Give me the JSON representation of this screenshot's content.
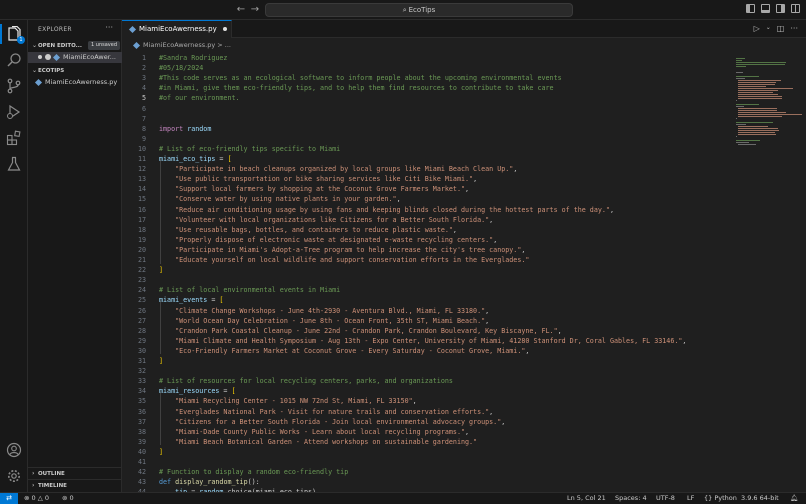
{
  "titlebar": {
    "search_text": "EcoTips"
  },
  "activity": {
    "explorer_badge": "1"
  },
  "sidebar": {
    "header": "EXPLORER",
    "more": "···",
    "open_editors_label": "OPEN EDITO...",
    "unsaved_label": "1 unsaved",
    "open_editor_file": "MiamiEcoAwer...",
    "folder_label": "ECOTIPS",
    "folder_file": "MiamiEcoAwerness.py",
    "outline_label": "OUTLINE",
    "timeline_label": "TIMELINE"
  },
  "editor": {
    "tab_label": "MiamiEcoAwerness.py",
    "breadcrumb": "MiamiEcoAwerness.py > ...",
    "current_line": 5,
    "lines": [
      "#Sandra Rodriguez",
      "#05/18/2024",
      "#This code serves as an ecological software to inform people about the upcoming environmental events",
      "#in Miami, give them eco-friendly tips, and to help them find resources to contribute to take care",
      "#of our environment.",
      "",
      "",
      "import random",
      "",
      "# List of eco-friendly tips specific to Miami",
      "miami_eco_tips = [",
      "    \"Participate in beach cleanups organized by local groups like Miami Beach Clean Up.\",",
      "    \"Use public transportation or bike sharing services like Citi Bike Miami.\",",
      "    \"Support local farmers by shopping at the Coconut Grove Farmers Market.\",",
      "    \"Conserve water by using native plants in your garden.\",",
      "    \"Reduce air conditioning usage by using fans and keeping blinds closed during the hottest parts of the day.\",",
      "    \"Volunteer with local organizations like Citizens for a Better South Florida.\",",
      "    \"Use reusable bags, bottles, and containers to reduce plastic waste.\",",
      "    \"Properly dispose of electronic waste at designated e-waste recycling centers.\",",
      "    \"Participate in Miami's Adopt-a-Tree program to help increase the city's tree canopy.\",",
      "    \"Educate yourself on local wildlife and support conservation efforts in the Everglades.\"",
      "]",
      "",
      "# List of local environmental events in Miami",
      "miami_events = [",
      "    \"Climate Change Workshops - June 4th-2930 - Aventura Blvd., Miami, FL 33180.\",",
      "    \"World Ocean Day Celebration - June 8th - Ocean Front, 35th ST, Miami Beach.\",",
      "    \"Crandon Park Coastal Cleanup - June 22nd - Crandon Park, Crandon Boulevard, Key Biscayne, FL.\",",
      "    \"Miami Climate and Health Symposium - Aug 13th - Expo Center, University of Miami, 41280 Stanford Dr, Coral Gables, FL 33146.\",",
      "    \"Eco-Friendly Farmers Market at Coconut Grove - Every Saturday - Coconut Grove, Miami.\",",
      "]",
      "",
      "# List of resources for local recycling centers, parks, and organizations",
      "miami_resources = [",
      "    \"Miami Recycling Center - 1015 NW 72nd St, Miami, FL 33150\",",
      "    \"Everglades National Park - Visit for nature trails and conservation efforts.\",",
      "    \"Citizens for a Better South Florida - Join local environmental advocacy groups.\",",
      "    \"Miami-Dade County Public Works - Learn about local recycling programs.\",",
      "    \"Miami Beach Botanical Garden - Attend workshops on sustainable gardening.\"",
      "]",
      "",
      "# Function to display a random eco-friendly tip",
      "def display_random_tip():",
      "    tip = random.choice(miami_eco_tips)"
    ]
  },
  "statusbar": {
    "errors": "0",
    "warnings": "0",
    "ports": "0",
    "position": "Ln 5, Col 21",
    "spaces": "Spaces: 4",
    "encoding": "UTF-8",
    "eol": "LF",
    "language": "Python",
    "interpreter": "3.9.6 64-bit"
  },
  "colors": {
    "accent": "#0078d4",
    "comment": "#6a9955",
    "string": "#ce9178",
    "keyword": "#c586c0"
  }
}
